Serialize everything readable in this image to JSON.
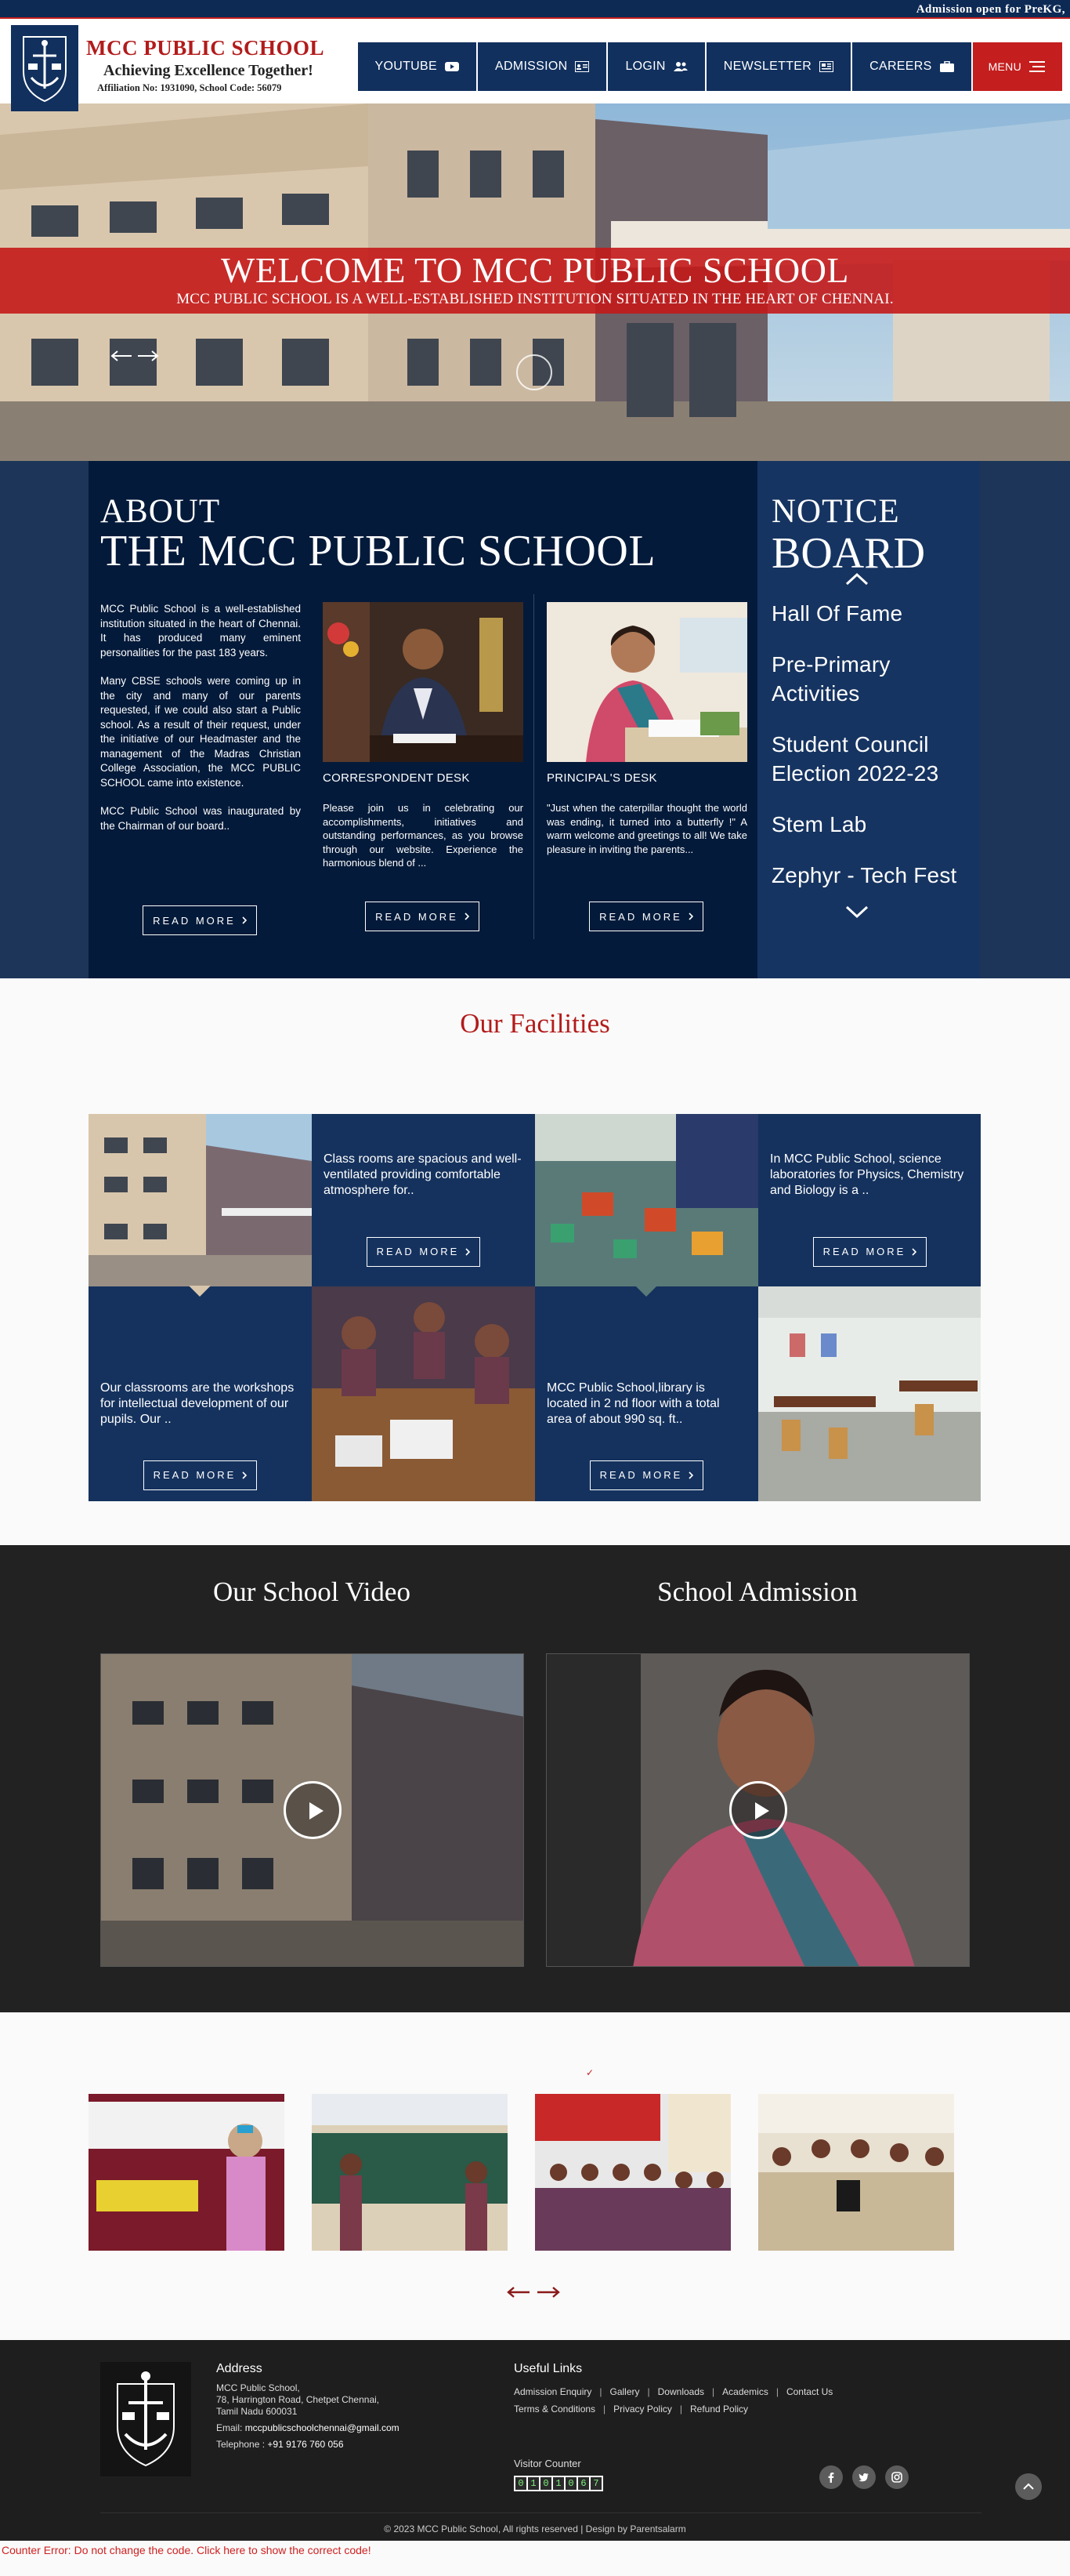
{
  "ticker": {
    "text": "Admission open for PreKG,"
  },
  "brand": {
    "name": "MCC PUBLIC SCHOOL",
    "tagline": "Achieving Excellence Together!",
    "affiliation": "Affiliation No: 1931090, School Code: 56079"
  },
  "nav": {
    "items": [
      {
        "label": "YOUTUBE",
        "icon": "youtube-icon"
      },
      {
        "label": "ADMISSION",
        "icon": "id-card-icon"
      },
      {
        "label": "LOGIN",
        "icon": "users-icon"
      },
      {
        "label": "NEWSLETTER",
        "icon": "newspaper-icon"
      },
      {
        "label": "CAREERS",
        "icon": "briefcase-icon"
      }
    ],
    "menu_label": "MENU"
  },
  "hero": {
    "title": "WELCOME TO MCC PUBLIC SCHOOL",
    "subtitle": "MCC PUBLIC SCHOOL IS A WELL-ESTABLISHED INSTITUTION SITUATED IN THE HEART OF CHENNAI."
  },
  "about": {
    "title_small": "ABOUT",
    "title_large": "THE MCC PUBLIC SCHOOL",
    "paragraphs": [
      "MCC Public School is a well-established institution situated in the heart of Chennai. It has produced many eminent personalities for the past 183 years.",
      "Many CBSE schools were coming up in the city and many of our parents requested, if we could also start a Public school. As a result of their request, under the initiative of our Headmaster and the management of the Madras Christian College Association, the MCC PUBLIC SCHOOL came into existence.",
      "MCC Public School was inaugurated by the Chairman of our board.."
    ],
    "read_more": "READ MORE",
    "correspondent": {
      "title": "CORRESPONDENT DESK",
      "text": "Please join us in celebrating our accomplishments, initiatives and outstanding performances, as you browse through our website. Experience the harmonious blend of ..."
    },
    "principal": {
      "title": "PRINCIPAL'S DESK",
      "text": "\"Just when the caterpillar thought the world was ending, it turned into a butterfly !\" A warm welcome and greetings to all! We take pleasure in inviting the parents..."
    }
  },
  "notice": {
    "title_small": "NOTICE",
    "title_large": "BOARD",
    "items": [
      "Hall Of Fame",
      "Pre-Primary Activities",
      "Student Council Election 2022-23",
      "Stem Lab",
      "Zephyr - Tech Fest"
    ]
  },
  "facilities": {
    "heading": "Our Facilities",
    "classrooms_text": "Class rooms are spacious and well-ventilated providing comfortable atmosphere for..",
    "labs_text": "In MCC Public School, science laboratories for Physics, Chemistry and Biology is a ..",
    "workshop_text": "Our classrooms are the workshops for intellectual development of our pupils. Our ..",
    "library_text": "MCC Public School,library is located in 2 nd floor with a total area of about 990 sq. ft..",
    "read_more": "READ MORE"
  },
  "video": {
    "school_video_title": "Our School Video",
    "admission_title": "School Admission"
  },
  "footer": {
    "address_heading": "Address",
    "address_lines": [
      "MCC Public School,",
      "78, Harrington Road, Chetpet Chennai,",
      "Tamil Nadu 600031"
    ],
    "email_label": "Email:",
    "email": "mccpublicschoolchennai@gmail.com",
    "phone_label": "Telephone :",
    "phone": "+91 9176 760 056",
    "useful_links_heading": "Useful Links",
    "links_row1": [
      "Admission Enquiry",
      "Gallery",
      "Downloads",
      "Academics",
      "Contact Us"
    ],
    "links_row2": [
      "Terms & Conditions",
      "Privacy Policy",
      "Refund Policy"
    ],
    "visitor_counter_label": "Visitor Counter",
    "visitor_count": "0101067",
    "copyright": "© 2023 MCC Public School, All rights reserved | Design by Parentsalarm",
    "social_icons": [
      "facebook-icon",
      "twitter-icon",
      "instagram-icon"
    ]
  },
  "error_text": "Counter Error: Do not change the code. Click here to show the correct code!",
  "colors": {
    "navy": "#11305e",
    "red": "#c41e1e",
    "dark_navy": "#041a3a",
    "notice_blue": "#163461"
  }
}
